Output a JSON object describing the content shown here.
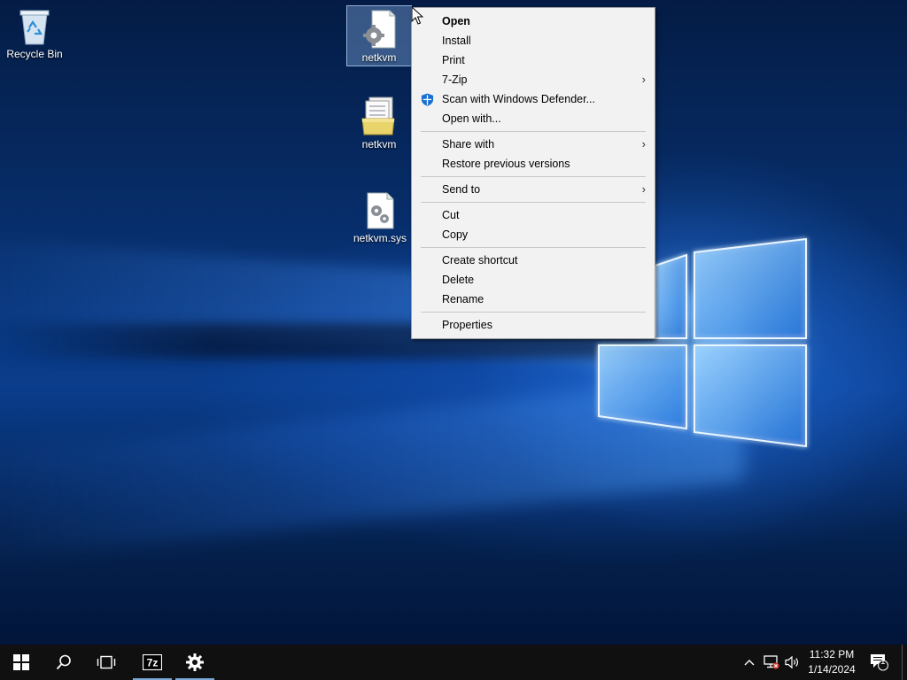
{
  "desktop": {
    "icons": [
      {
        "label": "Recycle Bin",
        "icon": "recycle-bin-icon"
      },
      {
        "label": "netkvm",
        "icon": "setup-information-file-icon"
      },
      {
        "label": "netkvm",
        "icon": "security-catalog-icon"
      },
      {
        "label": "netkvm.sys",
        "icon": "system-file-icon"
      }
    ]
  },
  "context_menu": {
    "groups": [
      [
        {
          "label": "Open",
          "bold": true
        },
        {
          "label": "Install"
        },
        {
          "label": "Print"
        },
        {
          "label": "7-Zip",
          "submenu": true
        },
        {
          "label": "Scan with Windows Defender...",
          "icon": "windows-defender-shield-icon"
        },
        {
          "label": "Open with..."
        }
      ],
      [
        {
          "label": "Share with",
          "submenu": true
        },
        {
          "label": "Restore previous versions"
        }
      ],
      [
        {
          "label": "Send to",
          "submenu": true
        }
      ],
      [
        {
          "label": "Cut"
        },
        {
          "label": "Copy"
        }
      ],
      [
        {
          "label": "Create shortcut"
        },
        {
          "label": "Delete"
        },
        {
          "label": "Rename"
        }
      ],
      [
        {
          "label": "Properties"
        }
      ]
    ]
  },
  "taskbar": {
    "buttons": [
      {
        "name": "start-button",
        "icon": "windows-logo-icon"
      },
      {
        "name": "search-button",
        "icon": "search-icon"
      },
      {
        "name": "task-view-button",
        "icon": "task-view-icon"
      },
      {
        "name": "7zip-taskbar-button",
        "icon": "7zip-icon",
        "active": true
      },
      {
        "name": "settings-taskbar-button",
        "icon": "gear-icon",
        "active": true
      }
    ],
    "tray": {
      "icons": [
        "chevron-up-icon",
        "network-disconnected-icon",
        "volume-icon"
      ],
      "time": "11:32 PM",
      "date": "1/14/2024",
      "notification_icon": "action-center-icon",
      "notification_count": "1"
    }
  },
  "colors": {
    "menu_background": "#f2f2f2",
    "taskbar_background": "#101010",
    "accent": "#7aa7d6",
    "defender_blue": "#1a6fd1"
  }
}
